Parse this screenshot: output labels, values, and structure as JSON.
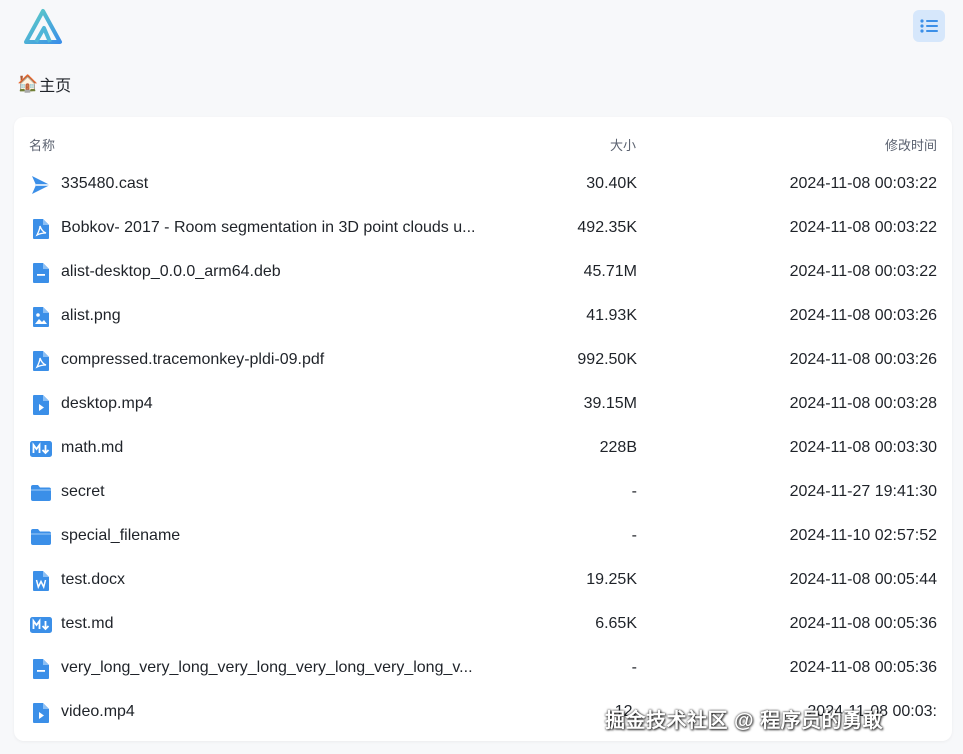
{
  "brand": {
    "logo_icon": "alist-logo-icon",
    "accent": "#3b8fe8"
  },
  "header": {
    "menu_icon": "list-icon"
  },
  "breadcrumb": {
    "home_emoji": "🏠",
    "label": "主页"
  },
  "table": {
    "columns": {
      "name": "名称",
      "size": "大小",
      "modified": "修改时间"
    },
    "rows": [
      {
        "name": "335480.cast",
        "size": "30.40K",
        "modified": "2024-11-08 00:03:22",
        "icon": "cast-file-icon"
      },
      {
        "name": "Bobkov- 2017 - Room segmentation in 3D point clouds u...",
        "size": "492.35K",
        "modified": "2024-11-08 00:03:22",
        "icon": "pdf-file-icon"
      },
      {
        "name": "alist-desktop_0.0.0_arm64.deb",
        "size": "45.71M",
        "modified": "2024-11-08 00:03:22",
        "icon": "generic-file-icon"
      },
      {
        "name": "alist.png",
        "size": "41.93K",
        "modified": "2024-11-08 00:03:26",
        "icon": "image-file-icon"
      },
      {
        "name": "compressed.tracemonkey-pldi-09.pdf",
        "size": "992.50K",
        "modified": "2024-11-08 00:03:26",
        "icon": "pdf-file-icon"
      },
      {
        "name": "desktop.mp4",
        "size": "39.15M",
        "modified": "2024-11-08 00:03:28",
        "icon": "video-file-icon"
      },
      {
        "name": "math.md",
        "size": "228B",
        "modified": "2024-11-08 00:03:30",
        "icon": "markdown-file-icon"
      },
      {
        "name": "secret",
        "size": "-",
        "modified": "2024-11-27 19:41:30",
        "icon": "folder-icon"
      },
      {
        "name": "special_filename",
        "size": "-",
        "modified": "2024-11-10 02:57:52",
        "icon": "folder-icon"
      },
      {
        "name": "test.docx",
        "size": "19.25K",
        "modified": "2024-11-08 00:05:44",
        "icon": "word-file-icon"
      },
      {
        "name": "test.md",
        "size": "6.65K",
        "modified": "2024-11-08 00:05:36",
        "icon": "markdown-file-icon"
      },
      {
        "name": "very_long_very_long_very_long_very_long_very_long_v...",
        "size": "-",
        "modified": "2024-11-08 00:05:36",
        "icon": "generic-file-icon"
      },
      {
        "name": "video.mp4",
        "size": "12.",
        "modified": "2024-11-08 00:03:",
        "icon": "video-file-icon"
      }
    ]
  },
  "watermark": "掘金技术社区 @ 程序员的勇敢"
}
